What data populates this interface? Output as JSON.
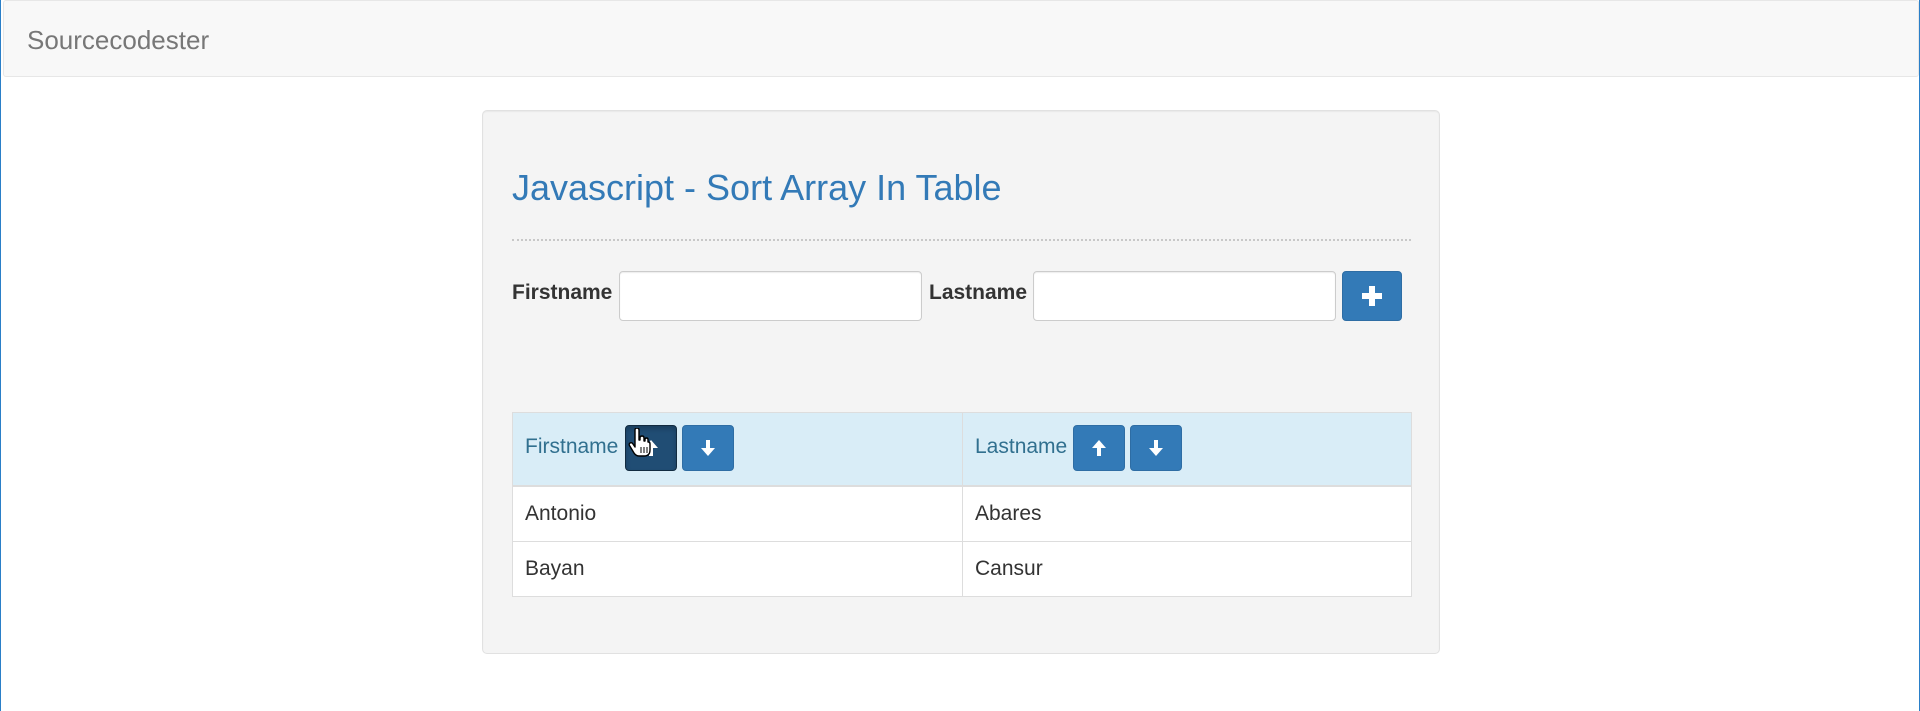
{
  "navbar": {
    "brand": "Sourcecodester"
  },
  "page": {
    "title": "Javascript - Sort Array In Table"
  },
  "form": {
    "firstname_label": "Firstname",
    "firstname_value": "",
    "lastname_label": "Lastname",
    "lastname_value": "",
    "add_icon": "plus-icon"
  },
  "table": {
    "columns": [
      {
        "label": "Firstname",
        "sort_asc_icon": "arrow-up-icon",
        "sort_desc_icon": "arrow-down-icon"
      },
      {
        "label": "Lastname",
        "sort_asc_icon": "arrow-up-icon",
        "sort_desc_icon": "arrow-down-icon"
      }
    ],
    "rows": [
      {
        "firstname": "Antonio",
        "lastname": "Abares"
      },
      {
        "firstname": "Bayan",
        "lastname": "Cansur"
      }
    ]
  },
  "colors": {
    "primary": "#337ab7",
    "primary_active": "#204d74",
    "header_bg": "#d9edf7",
    "header_text": "#31708f",
    "well_bg": "#f4f4f4",
    "navbar_bg": "#f8f8f8"
  }
}
